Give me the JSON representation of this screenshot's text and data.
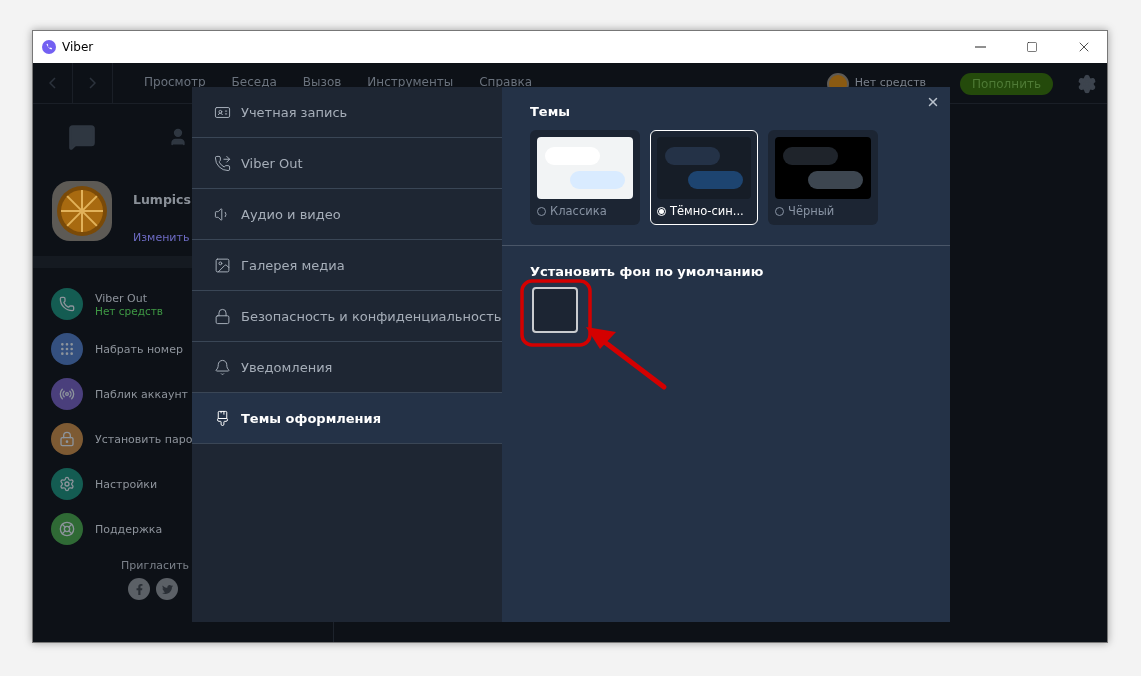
{
  "window": {
    "title": "Viber"
  },
  "menu": [
    "Просмотр",
    "Беседа",
    "Вызов",
    "Инструменты",
    "Справка"
  ],
  "account": {
    "balance": "Нет средств",
    "top_up": "Пополнить"
  },
  "sidebar": {
    "profile": {
      "name": "Lumpics",
      "edit": "Изменить"
    },
    "items": [
      {
        "kind": "viber_out",
        "label": "Viber Out",
        "sub": "Нет средств",
        "color": "#145c52"
      },
      {
        "kind": "dial",
        "label": "Набрать номер",
        "color": "#34507f"
      },
      {
        "kind": "public",
        "label": "Паблик аккаунт",
        "color": "#4a3f7c"
      },
      {
        "kind": "password",
        "label": "Установить паро",
        "color": "#7d5a33"
      },
      {
        "kind": "settings",
        "label": "Настройки",
        "color": "#145c52"
      },
      {
        "kind": "support",
        "label": "Поддержка",
        "color": "#2f6a35"
      }
    ],
    "invite": "Пригласить"
  },
  "settings": {
    "menu": [
      {
        "kind": "account",
        "label": "Учетная запись",
        "selected": false
      },
      {
        "kind": "viber_out",
        "label": "Viber Out",
        "selected": false
      },
      {
        "kind": "audio",
        "label": "Аудио и видео",
        "selected": false
      },
      {
        "kind": "gallery",
        "label": "Галерея медиа",
        "selected": false
      },
      {
        "kind": "security",
        "label": "Безопасность и конфиденциальность",
        "selected": false
      },
      {
        "kind": "notifications",
        "label": "Уведомления",
        "selected": false
      },
      {
        "kind": "themes",
        "label": "Темы оформления",
        "selected": true
      }
    ],
    "themes": {
      "title": "Темы",
      "options": [
        {
          "kind": "classic",
          "label": "Классика",
          "selected": false
        },
        {
          "kind": "dark_blue",
          "label": "Тёмно-син...",
          "selected": true
        },
        {
          "kind": "black",
          "label": "Чёрный",
          "selected": false
        }
      ]
    },
    "background": {
      "title": "Установить фон по умолчанию",
      "selected": true
    }
  }
}
